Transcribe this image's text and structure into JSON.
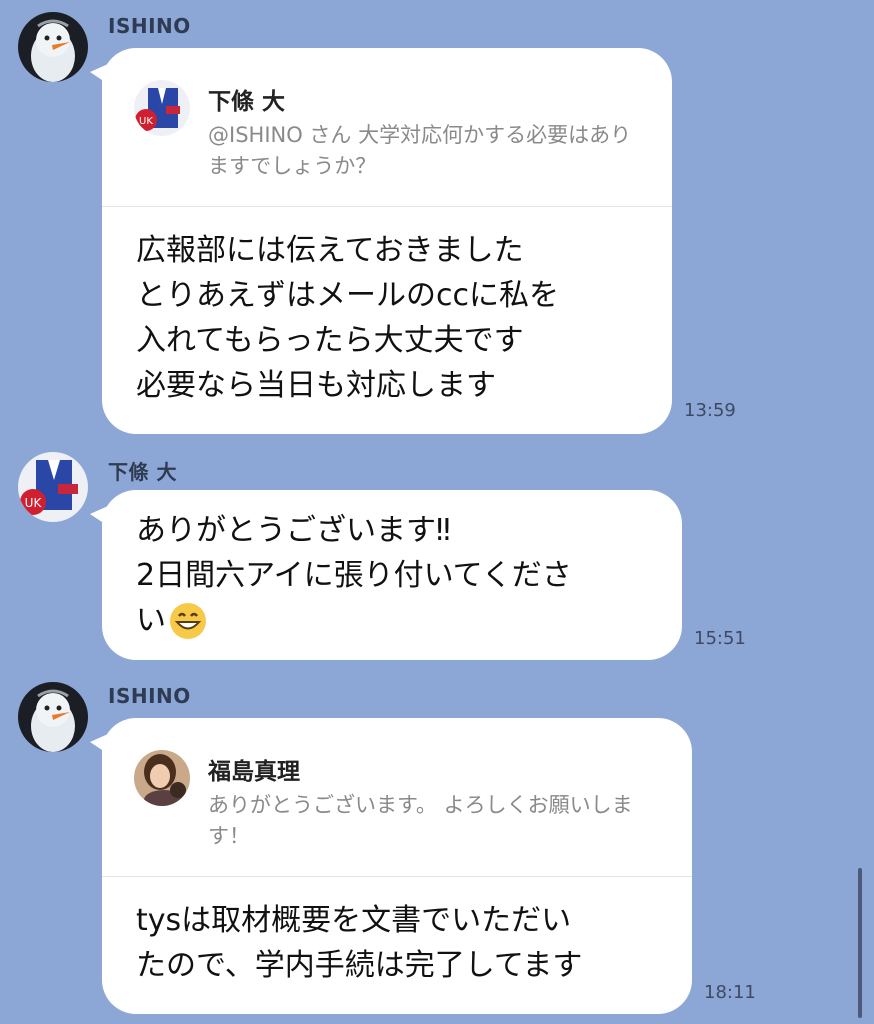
{
  "messages": [
    {
      "sender": "ISHINO",
      "reply_to": {
        "name": "下條 大",
        "text": "@ISHINO さん 大学対応何かする必要はありますでしょうか？"
      },
      "lines": [
        "広報部には伝えておきました",
        "とりあえずはメールのccに私を",
        "入れてもらったら大丈夫です",
        "必要なら当日も対応します"
      ],
      "time": "13:59"
    },
    {
      "sender": "下條 大",
      "lines": [
        "ありがとうございます‼︎",
        "2日間六アイに張り付いてくださ",
        "い"
      ],
      "emoji": "grinning-face-emoji",
      "time": "15:51"
    },
    {
      "sender": "ISHINO",
      "reply_to": {
        "name": "福島真理",
        "text": "ありがとうございます。 よろしくお願いします！"
      },
      "lines": [
        "tysは取材概要を文書でいただい",
        "たので、学内手続は完了してます"
      ],
      "time": "18:11"
    }
  ],
  "colors": {
    "background": "#8ca6d6",
    "bubble": "#ffffff",
    "quote_text": "#8a8a8a"
  }
}
